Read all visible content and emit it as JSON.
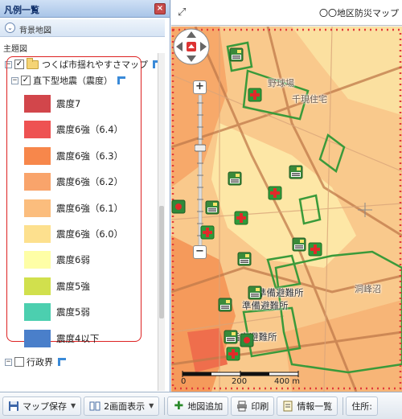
{
  "panel": {
    "title": "凡例一覧",
    "close_label": "×",
    "background_map_label": "背景地図",
    "theme_map_label": "主題図",
    "layer_group_label": "つくば市揺れやすさマップ",
    "layer_label": "直下型地震（震度）",
    "boundary_label": "行政界"
  },
  "legend": [
    {
      "label": "震度7",
      "color": "#d2464b"
    },
    {
      "label": "震度6強（6.4）",
      "color": "#ee5252"
    },
    {
      "label": "震度6強（6.3）",
      "color": "#f7874b"
    },
    {
      "label": "震度6強（6.2）",
      "color": "#f9a46b"
    },
    {
      "label": "震度6強（6.1）",
      "color": "#fbbd7d"
    },
    {
      "label": "震度6強（6.0）",
      "color": "#fde08e"
    },
    {
      "label": "震度6弱",
      "color": "#fefea6"
    },
    {
      "label": "震度5強",
      "color": "#d1e04d"
    },
    {
      "label": "震度5弱",
      "color": "#4ccfaf"
    },
    {
      "label": "震度4以下",
      "color": "#4a7fca"
    }
  ],
  "map": {
    "title": "〇〇地区防災マップ",
    "labels": {
      "area1": "野球場",
      "area2": "千現住宅",
      "area3": "洞峰沼",
      "evac1": "準備避難所",
      "evac2": "準備避難所",
      "evac3": "指定避難所"
    },
    "scale": {
      "t0": "0",
      "t1": "200",
      "t2": "400 m"
    }
  },
  "toolbar": {
    "save_map": "マップ保存",
    "dual_view": "2画面表示",
    "add_map": "地図追加",
    "print": "印刷",
    "info_list": "情報一覧",
    "address": "住所:"
  }
}
